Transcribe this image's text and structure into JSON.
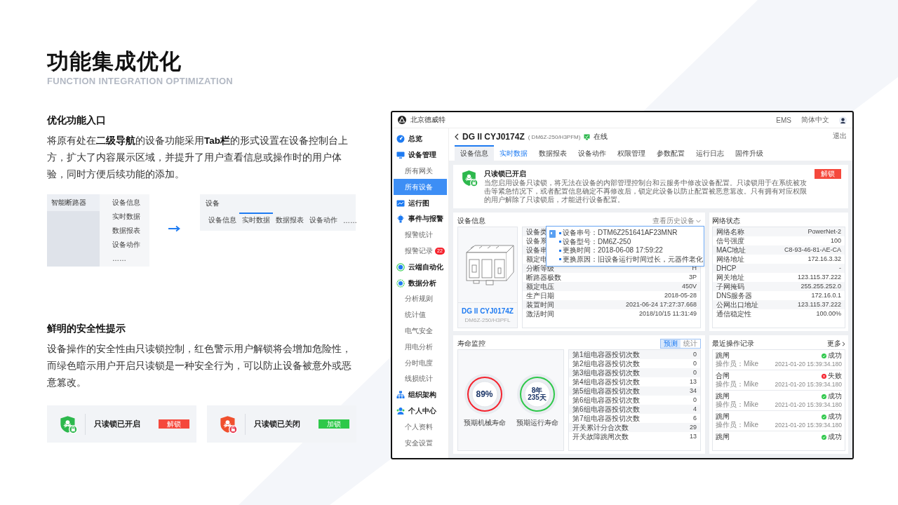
{
  "slide": {
    "title": "功能集成优化",
    "subtitle": "FUNCTION INTEGRATION OPTIMIZATION"
  },
  "entry_section": {
    "heading": "优化功能入口",
    "text": "将原有处在**二级导航**的设备功能采用**Tab栏**的形式设置在设备控制台上方，扩大了内容展示区域，并提升了用户查看信息或操作时的用户体验，同时方便后续功能的添加。",
    "before": {
      "menu_title": "智能断路器",
      "items": [
        "设备信息",
        "实时数据",
        "数据报表",
        "设备动作",
        "……"
      ]
    },
    "after": {
      "title": "设备",
      "tabs": [
        {
          "label": "设备信息",
          "selected": false
        },
        {
          "label": "实时数据",
          "selected": true
        },
        {
          "label": "数据报表",
          "selected": false
        },
        {
          "label": "设备动作",
          "selected": false
        },
        {
          "label": "……",
          "selected": false
        }
      ]
    }
  },
  "safety_section": {
    "heading": "鲜明的安全性提示",
    "text": "设备操作的安全性由只读锁控制，红色警示用户解锁将会增加危险性，而绿色暗示用户开启只读锁是一种安全行为，可以防止设备被意外或恶意篡改。",
    "lock_cards": [
      {
        "title": "只读锁已开启",
        "locked": true,
        "button": "解锁"
      },
      {
        "title": "只读锁已关闭",
        "locked": false,
        "button": "加锁"
      }
    ]
  },
  "app": {
    "company": "北京德威特",
    "top_links": [
      "EMS",
      "简体中文"
    ],
    "sidebar": [
      {
        "label": "总览"
      },
      {
        "label": "设备管理",
        "children": [
          {
            "label": "所有网关",
            "selected": false
          },
          {
            "label": "所有设备",
            "selected": true
          }
        ]
      },
      {
        "label": "运行图"
      },
      {
        "label": "事件与报警",
        "children": [
          {
            "label": "报警统计",
            "selected": false
          },
          {
            "label": "报警记录",
            "selected": false,
            "badge": "22"
          }
        ]
      },
      {
        "label": "云端自动化"
      },
      {
        "label": "数据分析",
        "children": [
          {
            "label": "分析规则",
            "selected": false
          },
          {
            "label": "统计值",
            "selected": false
          },
          {
            "label": "电气安全",
            "selected": false
          },
          {
            "label": "用电分析",
            "selected": false
          },
          {
            "label": "分时电度",
            "selected": false
          },
          {
            "label": "线损统计",
            "selected": false
          }
        ]
      },
      {
        "label": "组织架构"
      },
      {
        "label": "个人中心",
        "children": [
          {
            "label": "个人资料",
            "selected": false
          },
          {
            "label": "安全设置",
            "selected": false
          }
        ]
      }
    ],
    "device": {
      "name": "DG II CYJ0174Z",
      "model": "( DM6Z-250/H3PFM)",
      "status": "在线",
      "online": true,
      "exit": "退出"
    },
    "tabs": [
      {
        "label": "设备信息",
        "selected": true,
        "hovered": false
      },
      {
        "label": "实时数据",
        "selected": false,
        "hovered": true
      },
      {
        "label": "数据报表",
        "selected": false,
        "hovered": false
      },
      {
        "label": "设备动作",
        "selected": false,
        "hovered": false
      },
      {
        "label": "权限管理",
        "selected": false,
        "hovered": false
      },
      {
        "label": "参数配置",
        "selected": false,
        "hovered": false
      },
      {
        "label": "运行日志",
        "selected": false,
        "hovered": false
      },
      {
        "label": "固件升级",
        "selected": false,
        "hovered": false
      }
    ],
    "lock_notice": {
      "title": "只读锁已开启",
      "locked": true,
      "text": "当您启用设备只读锁，将无法在设备的内部管理控制台和云服务中修改设备配置。只读锁用于在系统被攻击等紧急情况下，或者配置信息确定不再修改后，锁定此设备以防止配置被恶意篡改。只有拥有对应权限的用户解除了只读锁后，才能进行设备配置。",
      "button": "解锁"
    },
    "device_info": {
      "title": "设备信息",
      "history_link": "查看历史设备",
      "image_name": "DG II CYJ0174Z",
      "image_model": "DM6Z-250/H3PFL",
      "rows": [
        {
          "label": "设备类"
        },
        {
          "label": "设备系"
        },
        {
          "label": "设备串"
        },
        {
          "label": "额定电"
        },
        {
          "label": "分断等级",
          "value": "H"
        },
        {
          "label": "断路器极数",
          "value": "3P"
        },
        {
          "label": "额定电压",
          "value": "450V"
        },
        {
          "label": "生产日期",
          "value": "2018-05-28"
        },
        {
          "label": "装置时间",
          "value": "2021-06-24 17:27:37.668"
        },
        {
          "label": "激活时间",
          "value": "2018/10/15 11:31:49"
        }
      ],
      "tooltip": [
        "设备串号：DTM6Z251641AF23MNR",
        "设备型号：DM6Z-250",
        "更换时间：2018-06-08 17:59:22",
        "更换原因：旧设备运行时间过长，元器件老化"
      ]
    },
    "network": {
      "title": "网络状态",
      "rows": [
        {
          "label": "网络名称",
          "value": "PowerNet-2"
        },
        {
          "label": "信号强度",
          "value": "100"
        },
        {
          "label": "MAC地址",
          "value": "C8-93-46-81-AE-CA"
        },
        {
          "label": "网络地址",
          "value": "172.16.3.32"
        },
        {
          "label": "DHCP",
          "value": "-"
        },
        {
          "label": "网关地址",
          "value": "123.115.37.222"
        },
        {
          "label": "子网掩码",
          "value": "255.255.252.0"
        },
        {
          "label": "DNS服务器",
          "value": "172.16.0.1"
        },
        {
          "label": "公网出口地址",
          "value": "123.115.37.222"
        },
        {
          "label": "通信稳定性",
          "value": "100.00%"
        }
      ]
    },
    "life": {
      "title": "寿命监控",
      "toggle": [
        {
          "label": "预测",
          "selected": true
        },
        {
          "label": "统计",
          "selected": false
        }
      ],
      "gauges": [
        {
          "lines": [
            "89%"
          ],
          "label": "预期机械寿命",
          "color": "#f5222d"
        },
        {
          "lines": [
            "8年",
            "235天"
          ],
          "label": "预期运行寿命",
          "color": "#2ec84a"
        }
      ],
      "rows": [
        {
          "label": "第1组电容器投切次数",
          "value": "0"
        },
        {
          "label": "第2组电容器投切次数",
          "value": "0"
        },
        {
          "label": "第3组电容器投切次数",
          "value": "0"
        },
        {
          "label": "第4组电容器投切次数",
          "value": "13"
        },
        {
          "label": "第5组电容器投切次数",
          "value": "34"
        },
        {
          "label": "第6组电容器投切次数",
          "value": "0"
        },
        {
          "label": "第6组电容器投切次数",
          "value": "4"
        },
        {
          "label": "第7组电容器投切次数",
          "value": "6"
        },
        {
          "label": "开关累计分合次数",
          "value": "29"
        },
        {
          "label": "开关故障跳闸次数",
          "value": "13"
        }
      ]
    },
    "records": {
      "title": "最近操作记录",
      "more": "更多",
      "items": [
        {
          "action": "跳闸",
          "result": "成功",
          "success": true,
          "operator": "操作员：Mike",
          "time": "2021-01-20 15:39:34.180"
        },
        {
          "action": "合闸",
          "result": "失败",
          "success": false,
          "operator": "操作员：Mike",
          "time": "2021-01-20 15:39:34.180"
        },
        {
          "action": "跳闸",
          "result": "成功",
          "success": true,
          "operator": "操作员：Mike",
          "time": "2021-01-20 15:39:34.180"
        },
        {
          "action": "跳闸",
          "result": "成功",
          "success": true,
          "operator": "操作员：Mike",
          "time": "2021-01-20 15:39:34.180"
        },
        {
          "action": "跳闸",
          "result": "成功",
          "success": true
        }
      ]
    }
  }
}
